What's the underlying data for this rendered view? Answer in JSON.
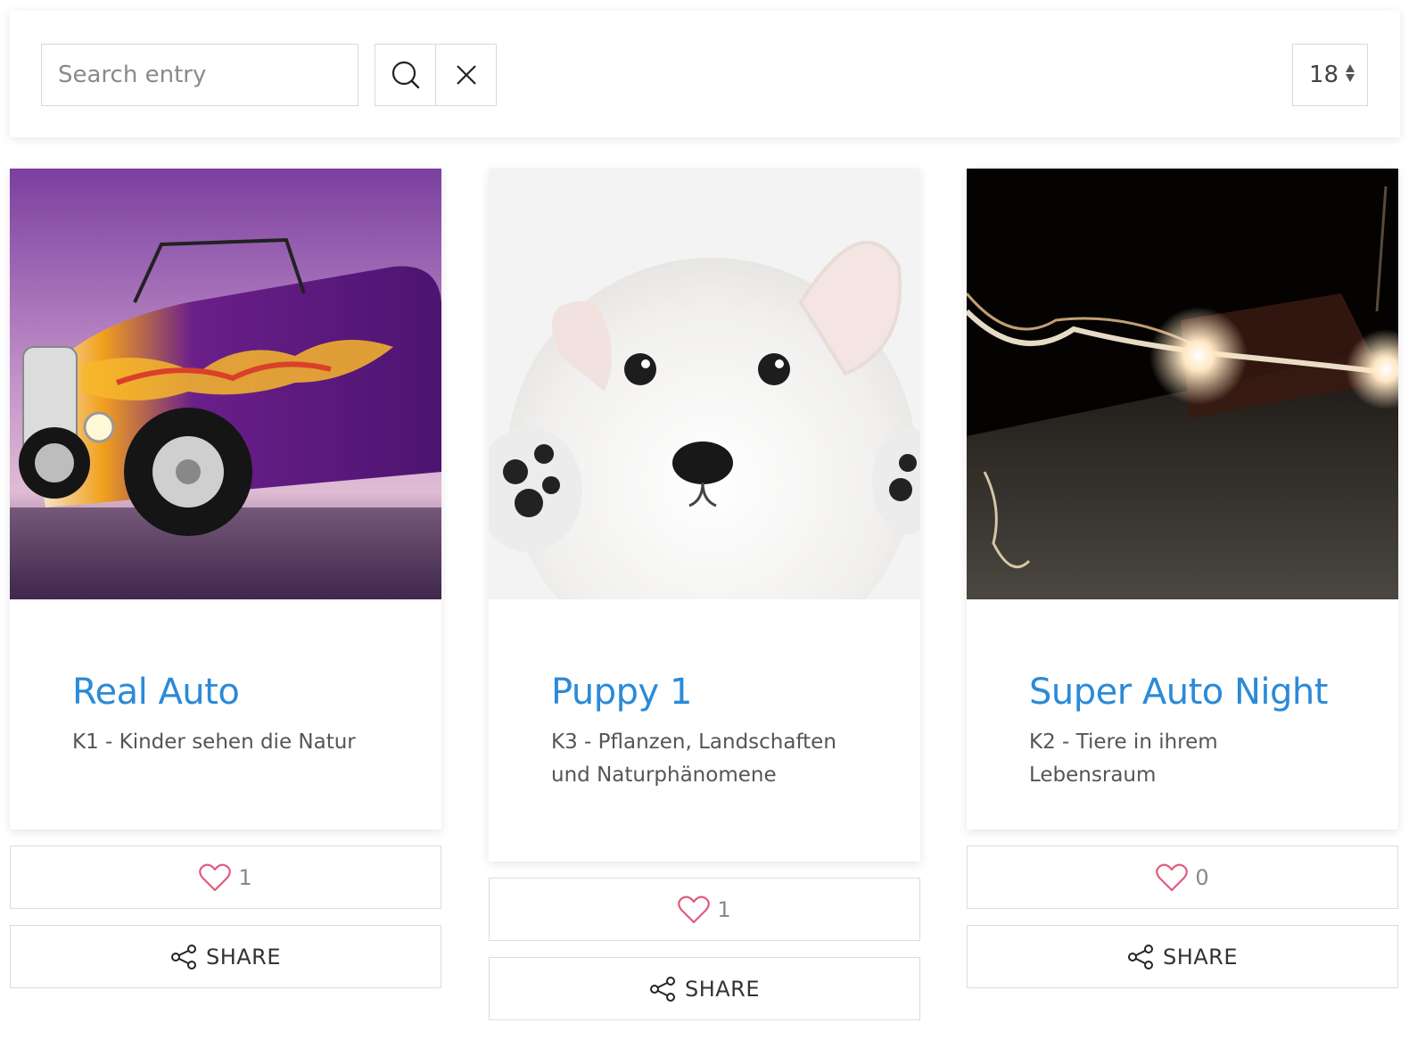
{
  "toolbar": {
    "search_placeholder": "Search entry",
    "search_value": "",
    "per_page": "18"
  },
  "colors": {
    "title": "#2b8ad8",
    "heart": "#e05a7d",
    "border": "#d9d9d9"
  },
  "cards": [
    {
      "title": "Real Auto",
      "category": "K1 - Kinder sehen die Natur",
      "image": "purple hot rod car with flames",
      "likes": "1",
      "share_label": "SHARE"
    },
    {
      "title": "Puppy 1",
      "category": "K3 - Pflanzen, Landschaften und Naturphänomene",
      "image": "white puppy with paws raised",
      "likes": "1",
      "share_label": "SHARE"
    },
    {
      "title": "Super Auto Night",
      "category": "K2 - Tiere in ihrem Lebensraum",
      "image": "car at night with light trails",
      "likes": "0",
      "share_label": "SHARE"
    }
  ]
}
